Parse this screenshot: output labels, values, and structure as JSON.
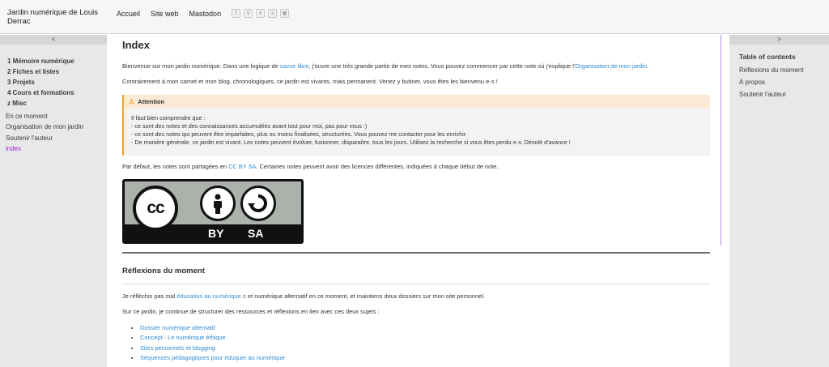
{
  "header": {
    "site_title": "Jardin numérique de Louis Derrac",
    "nav": [
      "Accueil",
      "Site web",
      "Mastodon"
    ],
    "tool_icons": [
      "text-icon",
      "search-icon",
      "shuffle-icon",
      "list-icon",
      "graph-icon"
    ]
  },
  "left_sidebar": {
    "collapse_label": "<",
    "sections": [
      "1 Mémoire numérique",
      "2 Fiches et listes",
      "3 Projets",
      "4 Cours et formations",
      "z Misc"
    ],
    "links": [
      "En ce moment",
      "Organisation de mon jardin",
      "Soutenir l'auteur"
    ],
    "active_link": "index"
  },
  "right_sidebar": {
    "collapse_label": ">",
    "toc_title": "Table of contents",
    "toc_items": [
      "Réflexions du moment",
      "À propos",
      "Soutenir l'auteur"
    ]
  },
  "main": {
    "title": "Index",
    "intro": {
      "before": "Bienvenue sur mon jardin numérique. Dans une logique de ",
      "link1": "savoir libre",
      "middle": ", j'ouvre une très grande partie de mes notes. Vous pouvez commencer par cette note où j'explique l'",
      "link2": "Organisation de mon jardin",
      "after": "."
    },
    "intro2": "Contrairement à mon carnet et mon blog, chronologiques, ce jardin est vivants, mais permanent. Venez y butiner, vous êtes les bienvenu·e·s !",
    "callout": {
      "title": "Attention",
      "lines": [
        "Il faut bien comprendre que :",
        "- ce sont des notes et des connaissances accumulées avant tout pour moi, pas pour vous :)",
        "- ce sont des notes qui peuvent être imparfaites, plus ou moins finalisées, structurées. Vous pouvez me contacter pour les enrichir.",
        "- De manière générale, ce jardin est vivant. Les notes peuvent évoluer, fusionner, disparaître, tous les jours. Utilisez la recherche si vous êtes perdu·e·s. Désolé d'avance !"
      ]
    },
    "license": {
      "before": "Par défaut, les notes sont partagées en ",
      "link": "CC BY SA",
      "after": ". Certaines notes peuvent avoir des licences différentes, indiquées à chaque début de note.",
      "badge_cc": "cc",
      "badge_by": "BY",
      "badge_sa": "SA"
    },
    "section": {
      "title": "Réflexions du moment",
      "p1_before": "Je réfléchis pas mal ",
      "p1_link": "éducation au numérique",
      "p1_after": " et numérique alternatif en ce moment, et maintiens deux dossiers sur mon site personnel.",
      "p2": "Sur ce jardin, je continue de structurer des ressources et réflexions en lien avec ces deux sujets :",
      "links": [
        "Dossier numérique alternatif",
        "Concept - Le numérique éthique",
        "Sites personnels et blogging",
        "Séquences pédagogiques pour éduquer au numérique"
      ]
    }
  }
}
